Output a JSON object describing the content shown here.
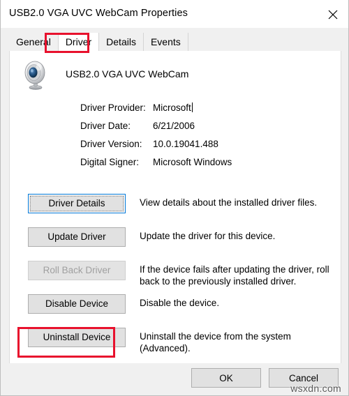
{
  "window": {
    "title": "USB2.0 VGA UVC WebCam Properties",
    "close_label": "✕"
  },
  "tabs": [
    {
      "label": "General",
      "active": false
    },
    {
      "label": "Driver",
      "active": true
    },
    {
      "label": "Details",
      "active": false
    },
    {
      "label": "Events",
      "active": false
    }
  ],
  "device": {
    "icon": "webcam-icon",
    "name": "USB2.0 VGA UVC WebCam"
  },
  "driver_info": [
    {
      "label": "Driver Provider:",
      "value": "Microsoft",
      "has_caret": true
    },
    {
      "label": "Driver Date:",
      "value": "6/21/2006",
      "has_caret": false
    },
    {
      "label": "Driver Version:",
      "value": "10.0.19041.488",
      "has_caret": false
    },
    {
      "label": "Digital Signer:",
      "value": "Microsoft Windows",
      "has_caret": false
    }
  ],
  "actions": [
    {
      "button": "Driver Details",
      "description": "View details about the installed driver files.",
      "state": "focused"
    },
    {
      "button": "Update Driver",
      "description": "Update the driver for this device.",
      "state": "normal"
    },
    {
      "button": "Roll Back Driver",
      "description": "If the device fails after updating the driver, roll back to the previously installed driver.",
      "state": "disabled"
    },
    {
      "button": "Disable Device",
      "description": "Disable the device.",
      "state": "normal"
    },
    {
      "button": "Uninstall Device",
      "description": "Uninstall the device from the system (Advanced).",
      "state": "normal"
    }
  ],
  "footer": {
    "ok_label": "OK",
    "cancel_label": "Cancel"
  },
  "watermark": "wsxdn.com",
  "colors": {
    "annotation": "#e8112d",
    "focus": "#0078d7",
    "window_bg": "#f0f0f0",
    "panel_bg": "#ffffff",
    "button_bg": "#e1e1e1"
  }
}
